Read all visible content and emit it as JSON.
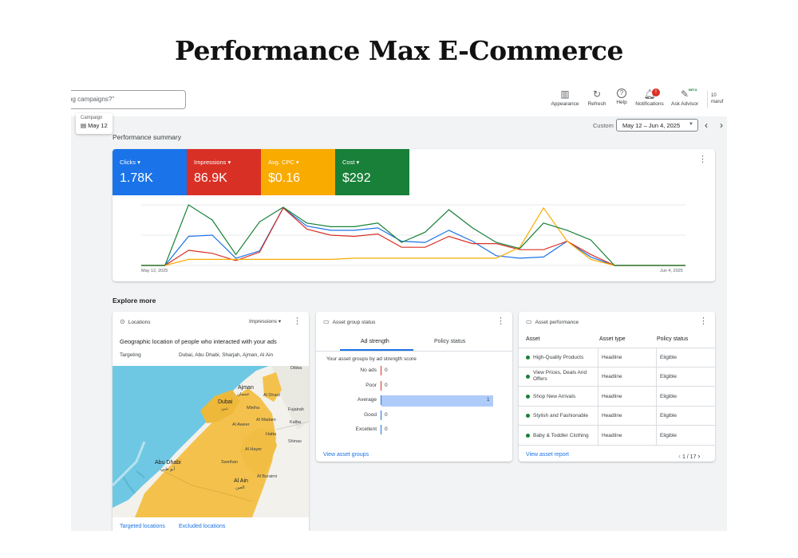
{
  "page_title": "Performance Max E-Commerce",
  "toolbar": {
    "search_text": "ng campaigns?\"",
    "items": [
      {
        "label": "Appearance",
        "icon": "appearance-icon",
        "glyph": "▥"
      },
      {
        "label": "Refresh",
        "icon": "refresh-icon",
        "glyph": "↻"
      },
      {
        "label": "Help",
        "icon": "help-icon",
        "glyph": "?"
      },
      {
        "label": "Notifications",
        "icon": "bell-icon",
        "glyph": "🔔︎"
      },
      {
        "label": "Ask Advisor",
        "icon": "advisor-icon",
        "glyph": "✎"
      }
    ],
    "notification_badge": "!",
    "beta_tag": "BETA",
    "account_line1": "10",
    "account_line2": "maruf"
  },
  "campaign_chip": {
    "label": "Campaign",
    "value": "May 12"
  },
  "date_filter": {
    "custom_label": "Custom",
    "range": "May 12 – Jun 4, 2025"
  },
  "performance_summary_label": "Performance summary",
  "metrics": [
    {
      "label": "Clicks",
      "value": "1.78K",
      "color": "#1a73e8"
    },
    {
      "label": "Impressions",
      "value": "86.9K",
      "color": "#d93025"
    },
    {
      "label": "Avg. CPC",
      "value": "$0.16",
      "color": "#f9ab00"
    },
    {
      "label": "Cost",
      "value": "$292",
      "color": "#188038"
    }
  ],
  "chart_data": {
    "type": "line",
    "x_start_label": "May 12, 2025",
    "x_end_label": "Jun 4, 2025",
    "grid": true,
    "ylim": [
      0,
      100
    ],
    "series": [
      {
        "color": "#1a73e8",
        "values": [
          0,
          0,
          48,
          50,
          12,
          24,
          95,
          65,
          58,
          58,
          62,
          40,
          38,
          58,
          40,
          16,
          12,
          14,
          40,
          14,
          0,
          0,
          0,
          0
        ]
      },
      {
        "color": "#d93025",
        "values": [
          0,
          0,
          25,
          20,
          8,
          22,
          95,
          60,
          50,
          48,
          52,
          30,
          30,
          48,
          36,
          36,
          26,
          26,
          40,
          18,
          0,
          0,
          0,
          0
        ]
      },
      {
        "color": "#f9ab00",
        "values": [
          0,
          0,
          10,
          10,
          10,
          10,
          10,
          10,
          10,
          12,
          12,
          12,
          12,
          12,
          12,
          12,
          30,
          95,
          40,
          10,
          0,
          0,
          0,
          0
        ]
      },
      {
        "color": "#188038",
        "values": [
          0,
          0,
          100,
          75,
          18,
          72,
          96,
          70,
          64,
          64,
          70,
          38,
          55,
          92,
          62,
          38,
          28,
          70,
          58,
          42,
          0,
          0,
          0,
          0
        ]
      }
    ]
  },
  "explore_more_label": "Explore more",
  "locations": {
    "title": "Locations",
    "metric": "Impressions",
    "subtitle": "Geographic location of people who interacted with your ads",
    "targeting_label": "Targeting",
    "targeting_value": "Dubai, Abu Dhabi, Sharjah, Ajman, Al Ain",
    "map_labels": [
      {
        "text": "Ajman",
        "cls": ""
      },
      {
        "text": "عجمان",
        "cls": "sm"
      },
      {
        "text": "Dubai",
        "cls": ""
      },
      {
        "text": "دبي",
        "cls": "sm"
      },
      {
        "text": "Abu Dhabi",
        "cls": ""
      },
      {
        "text": "أبو ظبي",
        "cls": "sm"
      },
      {
        "text": "Al Ain",
        "cls": ""
      },
      {
        "text": "العين",
        "cls": "sm"
      },
      {
        "text": "Al Aweer",
        "cls": "sm"
      },
      {
        "text": "Al Madam",
        "cls": "sm"
      },
      {
        "text": "Mleiha",
        "cls": "sm"
      },
      {
        "text": "Hatta",
        "cls": "sm"
      },
      {
        "text": "Shinas",
        "cls": "sm"
      },
      {
        "text": "Sweihan",
        "cls": "sm"
      },
      {
        "text": "Al Buraimi",
        "cls": "sm"
      },
      {
        "text": "Al Hayer",
        "cls": "sm"
      },
      {
        "text": "Dibba",
        "cls": "sm"
      },
      {
        "text": "Fujairah",
        "cls": "sm"
      },
      {
        "text": "Kalba",
        "cls": "sm"
      },
      {
        "text": "Al Dhaid",
        "cls": "sm"
      }
    ],
    "targeted_link": "Targeted locations",
    "excluded_link": "Excluded locations"
  },
  "asset_group_status": {
    "title": "Asset group status",
    "tabs": [
      "Ad strength",
      "Policy status"
    ],
    "subtitle": "Your asset groups by ad strength score",
    "rows": [
      {
        "label": "No ads",
        "value": 0,
        "color": "#d93025"
      },
      {
        "label": "Poor",
        "value": 0,
        "color": "#d93025"
      },
      {
        "label": "Average",
        "value": 1,
        "color": "#1a73e8"
      },
      {
        "label": "Good",
        "value": 0,
        "color": "#1a73e8"
      },
      {
        "label": "Excellent",
        "value": 0,
        "color": "#1a73e8"
      }
    ],
    "link": "View asset groups"
  },
  "asset_performance": {
    "title": "Asset performance",
    "columns": [
      "Asset",
      "Asset type",
      "Policy status"
    ],
    "rows": [
      {
        "asset": "High-Quality Products",
        "type": "Headline",
        "status": "Eligible"
      },
      {
        "asset": "View Prices, Deals And Offers",
        "type": "Headline",
        "status": "Eligible"
      },
      {
        "asset": "Shop New Arrivals",
        "type": "Headline",
        "status": "Eligible"
      },
      {
        "asset": "Stylish and Fashionable",
        "type": "Headline",
        "status": "Eligible"
      },
      {
        "asset": "Baby & Toddler Clothing",
        "type": "Headline",
        "status": "Eligible"
      }
    ],
    "link": "View asset report",
    "pagination": "1 / 17"
  }
}
